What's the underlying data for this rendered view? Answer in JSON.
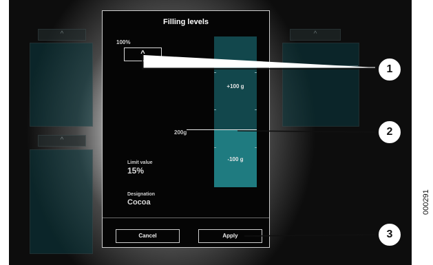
{
  "dialog": {
    "title": "Filling levels",
    "percent_label": "100%",
    "up_button_symbol": "^",
    "gauge": {
      "upper_label": "+100 g",
      "lower_label": "-100 g",
      "setpoint_label": "200g",
      "upper_color": "#12474c",
      "lower_color": "#1f7b80"
    },
    "limit": {
      "label": "Limit value",
      "value": "15%"
    },
    "designation": {
      "label": "Designation",
      "value": "Cocoa"
    },
    "buttons": {
      "cancel": "Cancel",
      "apply": "Apply"
    }
  },
  "background_panels": {
    "up_symbol": "^"
  },
  "callouts": [
    "1",
    "2",
    "3"
  ],
  "figure_id": "000291"
}
